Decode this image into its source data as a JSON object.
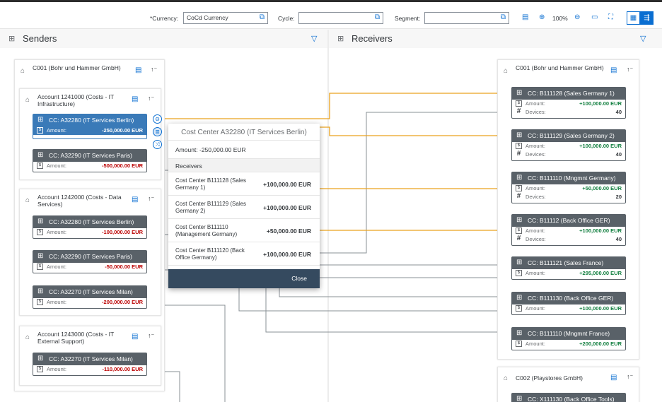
{
  "toolbar": {
    "currency_label": "*Currency:",
    "currency_value": "CoCd Currency",
    "cycle_label": "Cycle:",
    "cycle_value": "",
    "segment_label": "Segment:",
    "segment_value": "",
    "zoom_level": "100%"
  },
  "senders": {
    "title": "Senders",
    "company": "C001 (Bohr und Hammer GmbH)",
    "accounts": [
      {
        "title": "Account 1241000 (Costs - IT Infrastructure)",
        "nodes": [
          {
            "name": "CC: A32280 (IT Services Berlin)",
            "amount_label": "Amount:",
            "amount": "-250,000.00 EUR"
          },
          {
            "name": "CC: A32290 (IT Services Paris)",
            "amount_label": "Amount:",
            "amount": "-500,000.00 EUR"
          }
        ]
      },
      {
        "title": "Account 1242000 (Costs - Data Services)",
        "nodes": [
          {
            "name": "CC: A32280 (IT Services Berlin)",
            "amount_label": "Amount:",
            "amount": "-100,000.00 EUR"
          },
          {
            "name": "CC: A32290 (IT Services Paris)",
            "amount_label": "Amount:",
            "amount": "-50,000.00 EUR"
          },
          {
            "name": "CC: A32270 (IT Services Milan)",
            "amount_label": "Amount:",
            "amount": "-200,000.00 EUR"
          }
        ]
      },
      {
        "title": "Account 1243000 (Costs - IT External Support)",
        "nodes": [
          {
            "name": "CC: A32270 (IT Services Milan)",
            "amount_label": "Amount:",
            "amount": "-110,000.00 EUR"
          }
        ]
      }
    ]
  },
  "receivers": {
    "title": "Receivers",
    "company": "C001 (Bohr und Hammer GmbH)",
    "company2": "C002 (Playstores GmbH)",
    "nodes": [
      {
        "name": "CC: B111128 (Sales Germany 1)",
        "amount_label": "Amount:",
        "amount": "+100,000.00 EUR",
        "devices_label": "Devices:",
        "devices": "40"
      },
      {
        "name": "CC: B111129 (Sales Germany 2)",
        "amount_label": "Amount:",
        "amount": "+100,000.00 EUR",
        "devices_label": "Devices:",
        "devices": "40"
      },
      {
        "name": "CC: B111110 (Mngmnt Germany)",
        "amount_label": "Amount:",
        "amount": "+50,000.00 EUR",
        "devices_label": "Devices:",
        "devices": "20"
      },
      {
        "name": "CC: B11112 (Back Office GER)",
        "amount_label": "Amount:",
        "amount": "+100,000.00 EUR",
        "devices_label": "Devices:",
        "devices": "40"
      },
      {
        "name": "CC: B111121 (Sales France)",
        "amount_label": "Amount:",
        "amount": "+295,000.00 EUR"
      },
      {
        "name": "CC: B111130 (Back Office GER)",
        "amount_label": "Amount:",
        "amount": "+100,000.00 EUR"
      },
      {
        "name": "CC: B111110 (Mngmnt France)",
        "amount_label": "Amount:",
        "amount": "+200,000.00 EUR"
      },
      {
        "name": "CC: X111130 (Back Office Tools)"
      }
    ]
  },
  "popover": {
    "title": "Cost Center A32280 (IT Services Berlin)",
    "amount": "Amount: -250,000.00 EUR",
    "section": "Receivers",
    "rows": [
      {
        "name": "Cost Center B111128 (Sales Germany 1)",
        "value": "+100,000.00 EUR"
      },
      {
        "name": "Cost Center B111129 (Sales Germany 2)",
        "value": "+100,000.00 EUR"
      },
      {
        "name": "Cost Center B111110 (Management Germany)",
        "value": "+50,000.00 EUR"
      },
      {
        "name": "Cost Center B111120 (Back Office Germany)",
        "value": "+100,000.00 EUR"
      }
    ],
    "close_label": "Close"
  },
  "colors": {
    "accent": "#0a6ed1",
    "highlight_line": "#e9a21e",
    "node_header": "#596168",
    "selected_node": "#3a7ab8",
    "negative": "#bb0000",
    "positive": "#107e3e"
  }
}
